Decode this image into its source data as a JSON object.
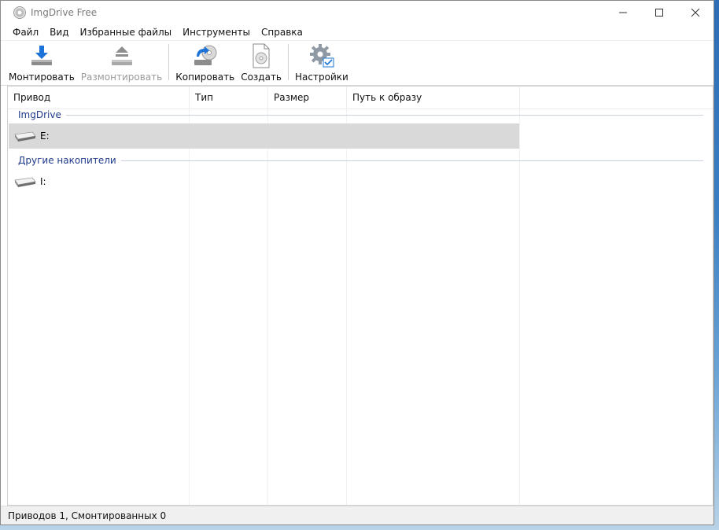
{
  "window": {
    "title": "ImgDrive Free"
  },
  "menu": {
    "items": [
      "Файл",
      "Вид",
      "Избранные файлы",
      "Инструменты",
      "Справка"
    ]
  },
  "toolbar": {
    "mount_label": "Монтировать",
    "unmount_label": "Размонтировать",
    "copy_label": "Копировать",
    "create_label": "Создать",
    "settings_label": "Настройки"
  },
  "list": {
    "columns": [
      "Привод",
      "Тип",
      "Размер",
      "Путь к образу"
    ],
    "groups": [
      {
        "label": "ImgDrive",
        "rows": [
          {
            "drive": "E:",
            "selected": true
          }
        ]
      },
      {
        "label": "Другие накопители",
        "rows": [
          {
            "drive": "I:",
            "selected": false
          }
        ]
      }
    ]
  },
  "status": {
    "text": "Приводов 1, Смонтированных 0"
  },
  "colors": {
    "accent": "#1e73d8",
    "group_text": "#1e3a8a",
    "selection": "#d9d9d9"
  }
}
